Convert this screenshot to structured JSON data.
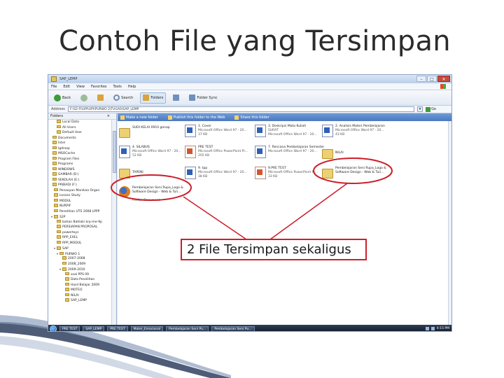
{
  "slide": {
    "title": "Contoh File yang Tersimpan",
    "callout": "2 File Tersimpan sekaligus"
  },
  "window": {
    "title": "SAP_LEMP",
    "menu": [
      "File",
      "Edit",
      "View",
      "Favorites",
      "Tools",
      "Help"
    ],
    "toolbar": {
      "back": "Back",
      "search": "Search",
      "folders": "Folders",
      "folder_sync": "Folder Sync"
    },
    "address": {
      "label": "Address",
      "value": "F:\\S2-FI\\UPI\\UPI\\PURWO 2\\TUGAS\\SAP_LEMP",
      "go": "Go"
    },
    "tasks": [
      "Make a new folder",
      "Publish this folder to the Web",
      "Share this folder"
    ],
    "tree": {
      "header": "Folders",
      "items": [
        "Local Data",
        "All Users",
        "Default User",
        "Documents",
        "Intel",
        "Igdrasp",
        "MSOCache",
        "Program Files",
        "Programs",
        "WINDOWS",
        "GAMBAR (D:)",
        "SEKOLAH (E:)",
        "PRIBADI (F:)",
        "Penaayan Manikoo Organ",
        "Lesson Study",
        "MODUL",
        "NURPIF",
        "Penelitian UTS 2008 LPPP",
        "S2P",
        "bahan Bahlaki krp-me-9p",
        "PERSIAPAN PROPOSAL",
        "powertoys",
        "RPP_EXEL",
        "RPP_MODUL",
        "SAP",
        "PURWO 1",
        "2007-2008",
        "2008_2009",
        "2009-2010",
        "soal PPS 09",
        "Data Penelitian",
        "Hasil Belajar 2009",
        "MOTEO",
        "NILAI",
        "SAP_LEMP"
      ]
    },
    "files": [
      {
        "name": "SUDI KELAI 0910 genap",
        "type": "",
        "size": ""
      },
      {
        "name": "1. Cover",
        "type": "Microsoft Office Word 97 - 20...",
        "size": "37 KB"
      },
      {
        "name": "3. Deskripsi Mata Kuliah",
        "type": "SURAT",
        "size": "Microsoft Office Word 97 - 20..."
      },
      {
        "name": "2. Analisis Materi Pembelajaran",
        "type": "Microsoft Office Word 97 - 20...",
        "size": "43 KB"
      },
      {
        "name": "4. SILABUS",
        "type": "Microsoft Office Word 97 - 20...",
        "size": "52 KB"
      },
      {
        "name": "PRE TEST",
        "type": "Microsoft Office PowerPoint Pr...",
        "size": "205 KB"
      },
      {
        "name": "7. Rencana Pembelajaran Semester",
        "type": "Microsoft Office Word 97 - 20...",
        "size": ""
      },
      {
        "name": "NILAI",
        "type": "",
        "size": ""
      },
      {
        "name": "TAPENI",
        "type": "",
        "size": ""
      },
      {
        "name": "9. tpp",
        "type": "Microsoft Office Word 97 - 20...",
        "size": "38 KB"
      },
      {
        "name": "9.PRE TEST",
        "type": "Microsoft Office PowerPoint Pr...",
        "size": "33 KB"
      },
      {
        "name": "Pembelajaran Seni Rupa_Logo & Software Design - Web & Tuli...",
        "type": "",
        "size": ""
      },
      {
        "name": "Pembelajaran Seni Rupa_Logo & Software Design - Web & Tuli...",
        "type": "Firefox Document",
        "size": ""
      }
    ],
    "taskbar": {
      "tasks": [
        "PRE TEST",
        "SAP_LEMP",
        "PRE TEST",
        "Mater_Emocional",
        "Pembelajaran Seni Pu...",
        "Pembelajaran Seni Pu..."
      ],
      "clock": "4:15 PM"
    }
  }
}
